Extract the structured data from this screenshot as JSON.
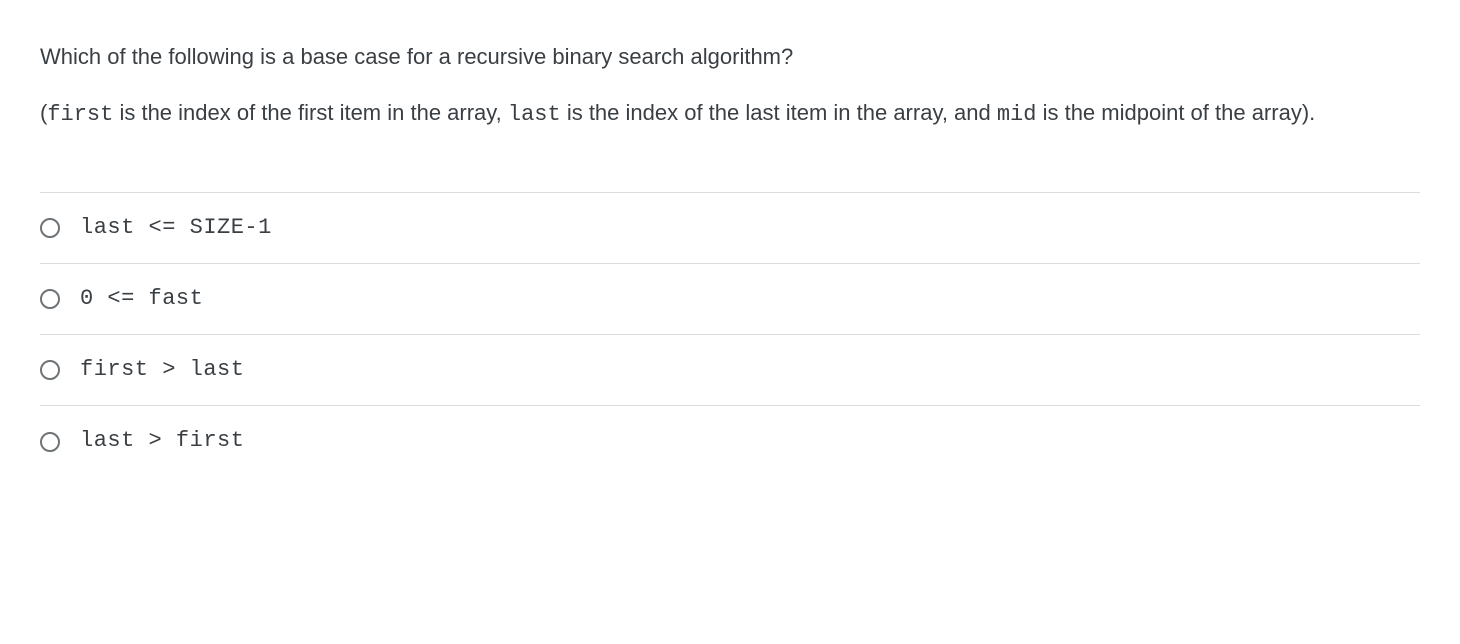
{
  "question": {
    "line1": "Which of the following is a base case for a recursive binary search algorithm?",
    "line2_pre": "(",
    "line2_code1": "first",
    "line2_mid1": " is the index of the first item in the array, ",
    "line2_code2": "last",
    "line2_mid2": " is the index of the last item in the array, and ",
    "line2_code3": "mid",
    "line2_post": " is the midpoint of the array)."
  },
  "options": [
    {
      "label": "last <= SIZE-1"
    },
    {
      "label": "0 <= fast"
    },
    {
      "label": "first > last"
    },
    {
      "label": "last > first"
    }
  ]
}
